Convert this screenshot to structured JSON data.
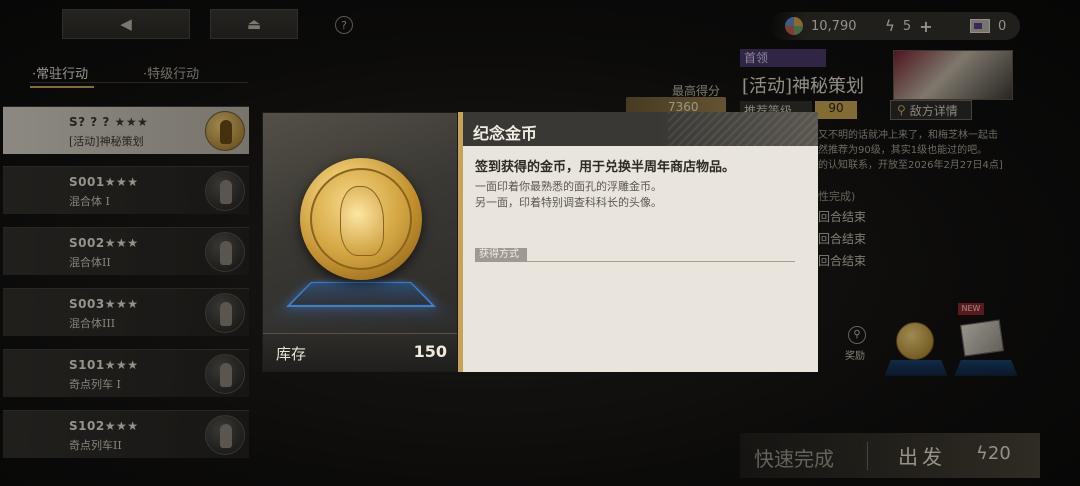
{
  "top": {
    "back_icon": "back-arrow-icon",
    "home_icon": "home-icon",
    "help_label": "?",
    "resources": [
      {
        "icon": "currency-icon",
        "value": "10,790"
      },
      {
        "icon": "energy-bolt-icon",
        "value": "5",
        "plus": "+"
      },
      {
        "icon": "ticket-icon",
        "value": "0"
      }
    ]
  },
  "tabs": [
    {
      "label": "·常驻行动",
      "active": true
    },
    {
      "label": "·特级行动",
      "active": false
    }
  ],
  "stages": [
    {
      "code": "S? ? ? ★★★",
      "name": "[活动]神秘策划",
      "selected": true
    },
    {
      "code": "S001★★★",
      "name": "混合体 I",
      "selected": false
    },
    {
      "code": "S002★★★",
      "name": "混合体II",
      "selected": false
    },
    {
      "code": "S003★★★",
      "name": "混合体III",
      "selected": false
    },
    {
      "code": "S101★★★",
      "name": "奇点列车 I",
      "selected": false
    },
    {
      "code": "S102★★★",
      "name": "奇点列车II",
      "selected": false
    }
  ],
  "detail": {
    "tag": "首领",
    "title": "[活动]神秘策划",
    "recommend_label": "推荐等级",
    "recommend_level": "90",
    "enemy_button": "敌方详情",
    "best_label": "最高得分",
    "best_value": "7360",
    "description_lines": [
      "又不明的话就冲上来了，和梅芝林一起击",
      "然推荐为90级，其实1级也能过的吧。",
      "的认知联系，开放至2026年2月27日4点]"
    ],
    "objective_header": "性完成)",
    "objectives": [
      "回合结束",
      "回合结束",
      "回合结束"
    ],
    "reward_label": "奖励",
    "new_badge": "NEW",
    "quick_complete": "快速完成",
    "depart": "出发",
    "cost": "20"
  },
  "modal": {
    "title": "纪念金币",
    "stock_label": "库存",
    "stock_value": "150",
    "main_desc": "签到获得的金币，用于兑换半周年商店物品。",
    "sub_desc_1": "一面印着你最熟悉的面孔的浮雕金币。",
    "sub_desc_2": "另一面，印着特别调查科科长的头像。",
    "source_label": "获得方式"
  },
  "colors": {
    "accent_gold": "#c6a35a",
    "panel_light": "#e9e5dc",
    "boss_tag": "#4b3a6b",
    "platform_blue": "#3c7fd1"
  }
}
